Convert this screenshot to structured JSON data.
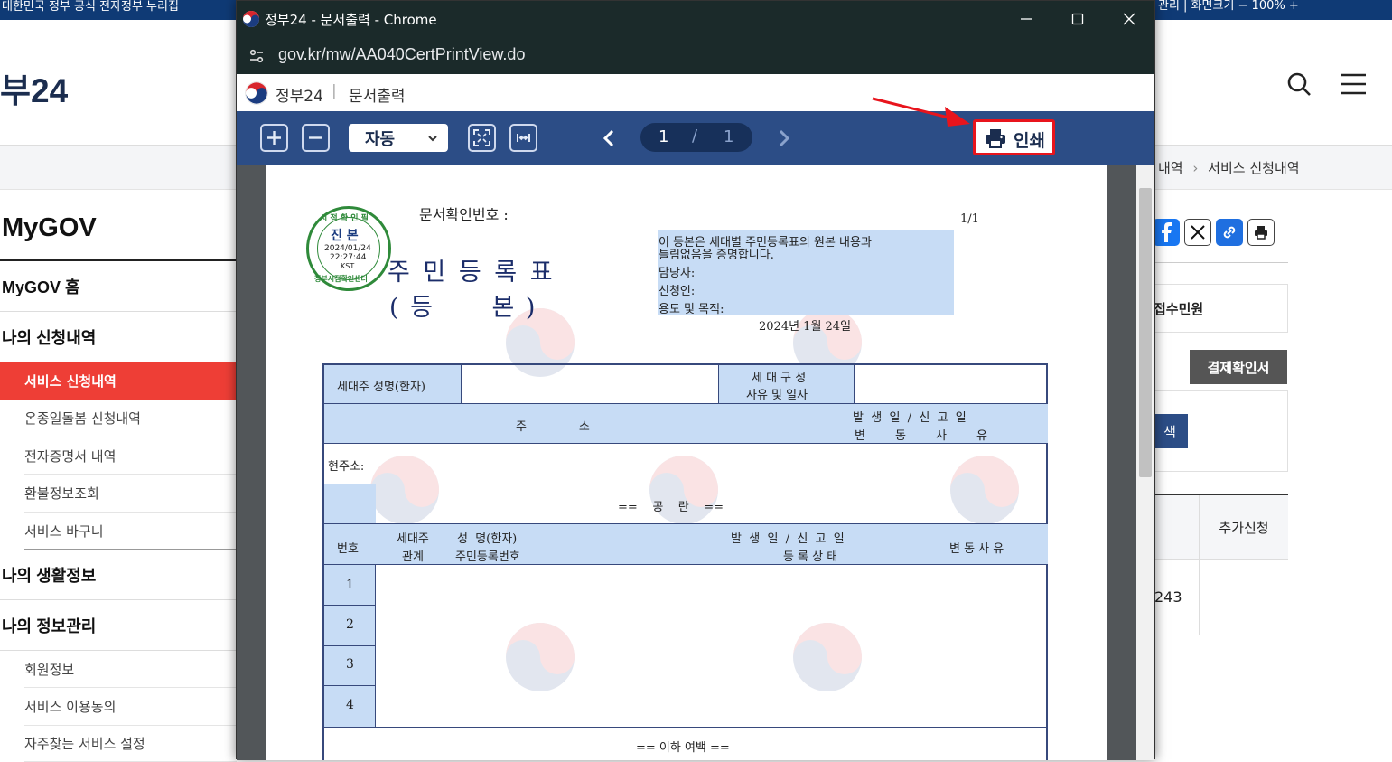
{
  "bg": {
    "topbar_left": "대한민국 정부 공식 전자정부 누리집",
    "topbar_right": "관리 | 화면크기 − 100% +",
    "logo": "부24",
    "breadcrumb": [
      "내역",
      "서비스 신청내역"
    ],
    "sidebar": {
      "title": "MyGOV",
      "home": "MyGOV 홈",
      "apply_header": "나의 신청내역",
      "apply_items": [
        "서비스 신청내역",
        "온종일돌봄 신청내역",
        "전자증명서 내역",
        "환불정보조회",
        "서비스 바구니"
      ],
      "life": "나의 생활정보",
      "info": "나의 정보관리",
      "info_items": [
        "회원정보",
        "서비스 이용동의",
        "자주찾는 서비스 설정"
      ]
    },
    "right": {
      "tab_label": "접수민원",
      "pay_button": "결제확인서",
      "search_btn": "색",
      "col_add": "추가신청",
      "cell_num": "243"
    }
  },
  "popup": {
    "title": "정부24 - 문서출력 - Chrome",
    "url": "gov.kr/mw/AA040CertPrintView.do",
    "site_name": "정부24",
    "site_sep": "|",
    "site_page": "문서출력",
    "zoom": "자동",
    "page_current": "1",
    "page_sep": "/",
    "page_total": "1",
    "print_label": "인쇄",
    "accent": "#e8141c"
  },
  "doc": {
    "page_mark": "1/1",
    "confirm_label": "문서확인번호 :",
    "title": "주 민 등 록 표",
    "subtitle": "( 등      본 )",
    "stamp": {
      "top": "시 점 확 인 필",
      "center": "진 본",
      "date": "2024/01/24",
      "time": "22:27:44",
      "tz": "KST",
      "bottom": "정부시점확인센터"
    },
    "notice": {
      "line1": "이 등본은 세대별 주민등록표의 원본 내용과",
      "line2": "틀림없음을 증명합니다.",
      "line3": "담당자:",
      "line4": "신청인:",
      "line5": "용도 및 목적:"
    },
    "date": "2024년 1월 24일",
    "table": {
      "householder": "세대주 성명(한자)",
      "house_form1": "세 대 구 성",
      "house_form2": "사유 및 일자",
      "addr": "주              소",
      "report1": "발  생  일  /  신  고  일",
      "report2": "변        동        사        유",
      "current_addr": "현주소:",
      "blank": "==    공    란    ==",
      "col_no": "번호",
      "col_rel1": "세대주",
      "col_rel2": "관계",
      "col_name1": "성  명(한자)",
      "col_name2": "주민등록번호",
      "col_date1": "발  생  일  /  신  고  일",
      "col_date2": "등 록 상 태",
      "col_reason": "변 동 사 유",
      "rows": [
        "1",
        "2",
        "3",
        "4"
      ],
      "end": "== 이하 여백 =="
    }
  }
}
